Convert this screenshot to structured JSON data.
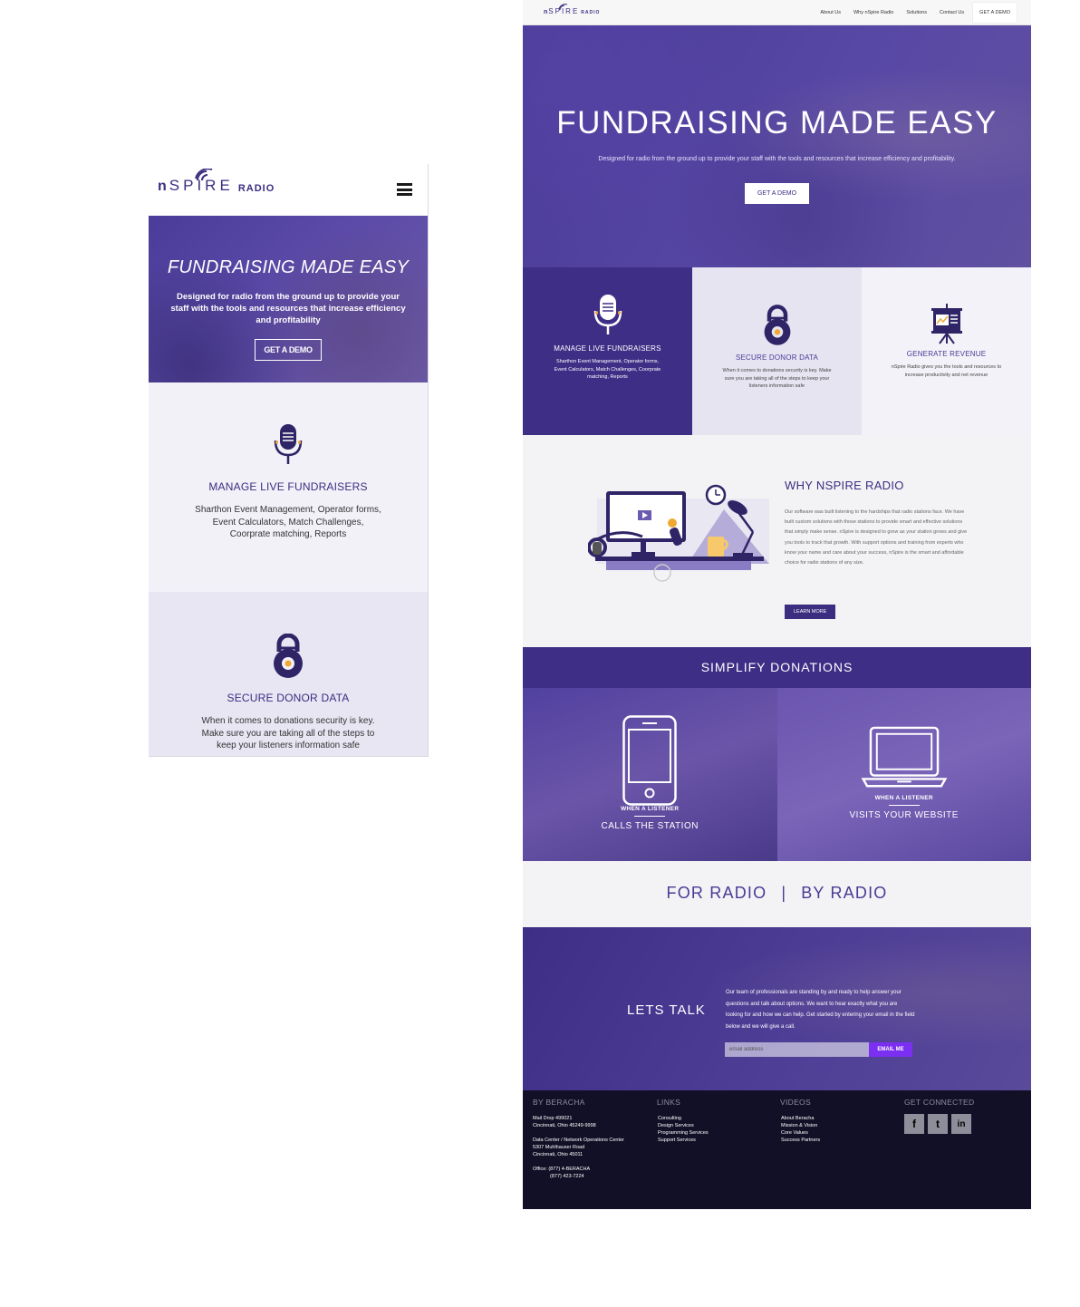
{
  "brand": {
    "logo_n": "n",
    "logo_spire": "SPIRE",
    "logo_radio": "RADIO",
    "accent": "#3b2d80",
    "hero_purple": "#4a3a96"
  },
  "mobile": {
    "hero": {
      "title": "FUNDRAISING MADE EASY",
      "subtitle": "Designed for radio from the ground up to provide your staff with the tools and resources that increase efficiency and profitability",
      "button": "GET A DEMO"
    },
    "features": [
      {
        "icon": "microphone-icon",
        "title": "MANAGE LIVE FUNDRAISERS",
        "desc": "Sharthon Event Management, Operator forms, Event Calculators, Match Challenges, Coorprate matching, Reports"
      },
      {
        "icon": "padlock-icon",
        "title": "SECURE DONOR DATA",
        "desc": "When it comes to donations security is key. Make sure you are taking all of the steps to keep your listeners information safe"
      }
    ]
  },
  "desktop": {
    "nav": {
      "items": [
        "About Us",
        "Why nSpire Radio",
        "Solutions",
        "Contact Us"
      ],
      "demo": "GET A DEMO"
    },
    "hero": {
      "title": "FUNDRAISING MADE EASY",
      "subtitle": "Designed for radio from the ground up to provide your staff with the tools and resources that increase efficiency and profitability.",
      "button": "GET A DEMO"
    },
    "features": [
      {
        "icon": "microphone-icon",
        "title": "MANAGE LIVE FUNDRAISERS",
        "desc": "Sharthon Event Management, Operator forms, Event Calculators, Match Challenges, Coorprate matching, Reports"
      },
      {
        "icon": "padlock-icon",
        "title": "SECURE DONOR DATA",
        "desc": "When it comes to donations security is key. Make sure you are taking all of the steps to keep your listeners information safe"
      },
      {
        "icon": "presentation-board-icon",
        "title": "GENERATE REVENUE",
        "desc": "nSpire Radio gives you the tools and resources to increase productivity and net revenue"
      }
    ],
    "why": {
      "title": "WHY NSPIRE RADIO",
      "text": "Our software was built listening to the hardships that radio stations face. We have built custom solutions with those stations to provide smart and effective solutions that simply make sense. nSpire is designed to grow as your station grows and give you tools to track that growth. With support options and training from experts who know your name and care about your success, nSpire is the smart and affordable choice for radio stations of any size.",
      "button": "LEARN MORE"
    },
    "simplify": "SIMPLIFY DONATIONS",
    "donate": [
      {
        "icon": "smartphone-icon",
        "small": "WHEN A LISTENER",
        "big": "CALLS THE STATION"
      },
      {
        "icon": "laptop-icon",
        "small": "WHEN A LISTENER",
        "big": "VISITS YOUR WEBSITE"
      }
    ],
    "for_radio": {
      "left": "FOR RADIO",
      "sep": "|",
      "right": "BY RADIO"
    },
    "talk": {
      "title": "LETS TALK",
      "text": "Our team of professionals are standing by and ready to help answer your questions and talk about options. We want to hear exactly what you are looking for and how we can help. Get started by entering your email in the field below and we will give a call.",
      "placeholder": "email address",
      "button": "EMAIL ME"
    },
    "footer": {
      "beracha": {
        "heading": "BY BERACHA",
        "lines": [
          "Mail Drop 499021",
          "Cincinnati, Ohio 45249-9998",
          "",
          "Data Center / Network Operations Center",
          "5307 Muhlhauser Road",
          "Cincinnati, Ohio  45011",
          "",
          "Office: (877) 4-BERACHA",
          "(877) 423-7224"
        ]
      },
      "links": {
        "heading": "LINKS",
        "items": [
          "Consulting",
          "Design Services",
          "Programming Services",
          "Support Services"
        ]
      },
      "videos": {
        "heading": "VIDEOS",
        "items": [
          "About Beracha",
          "Mission & Vision",
          "Core Values",
          "Success Partners"
        ]
      },
      "connect": {
        "heading": "GET CONNECTED",
        "icons": [
          "facebook-icon",
          "twitter-icon",
          "linkedin-icon"
        ],
        "glyphs": [
          "f",
          "t",
          "in"
        ]
      }
    }
  }
}
